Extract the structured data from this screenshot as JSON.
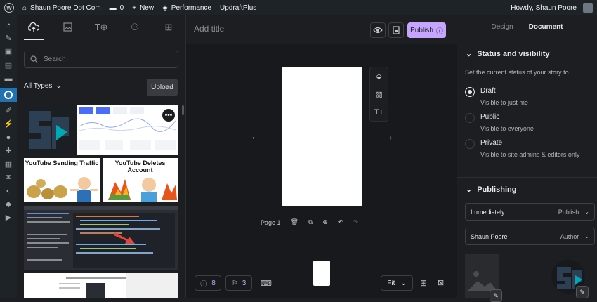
{
  "adminbar": {
    "site_name": "Shaun Poore Dot Com",
    "comments_count": "0",
    "new_label": "New",
    "performance_label": "Performance",
    "updraft_label": "UpdraftPlus",
    "howdy": "Howdy, Shaun Poore"
  },
  "wpmenu": {
    "icons": [
      "dashboard-icon",
      "pin-icon",
      "media-icon",
      "pages-icon",
      "comments-icon",
      "web-stories-icon",
      "appearance-icon",
      "plugins-icon",
      "users-icon",
      "tools-icon",
      "settings-icon",
      "mail-icon",
      "seo-icon",
      "layers-icon",
      "play-icon"
    ]
  },
  "library": {
    "tab_icons": [
      "upload-icon",
      "image-icon",
      "text-icon",
      "shapes-icon",
      "templates-icon"
    ],
    "search_placeholder": "Search",
    "filter_label": "All Types",
    "upload_label": "Upload",
    "thumbs": {
      "t3_title": "YouTube Sending Traffic",
      "t4_title": "YouTube Deletes Account"
    }
  },
  "editor": {
    "title_placeholder": "Add title",
    "publish_label": "Publish",
    "page_label": "Page 1",
    "help_count": "8",
    "checklist_count": "3",
    "zoom_label": "Fit"
  },
  "panel": {
    "tabs": [
      "Design",
      "Document"
    ],
    "status_section": "Status and visibility",
    "status_desc": "Set the current status of your story to",
    "options": [
      {
        "label": "Draft",
        "sub": "Visible to just me",
        "checked": true
      },
      {
        "label": "Public",
        "sub": "Visible to everyone",
        "checked": false
      },
      {
        "label": "Private",
        "sub": "Visible to site admins & editors only",
        "checked": false
      }
    ],
    "publishing_section": "Publishing",
    "publish_time": "Immediately",
    "publish_role": "Publish",
    "author_name": "Shaun Poore",
    "author_role": "Author"
  },
  "colors": {
    "accent": "#c5a5ff",
    "wp_blue": "#2271b1",
    "background": "#1d1e21"
  }
}
